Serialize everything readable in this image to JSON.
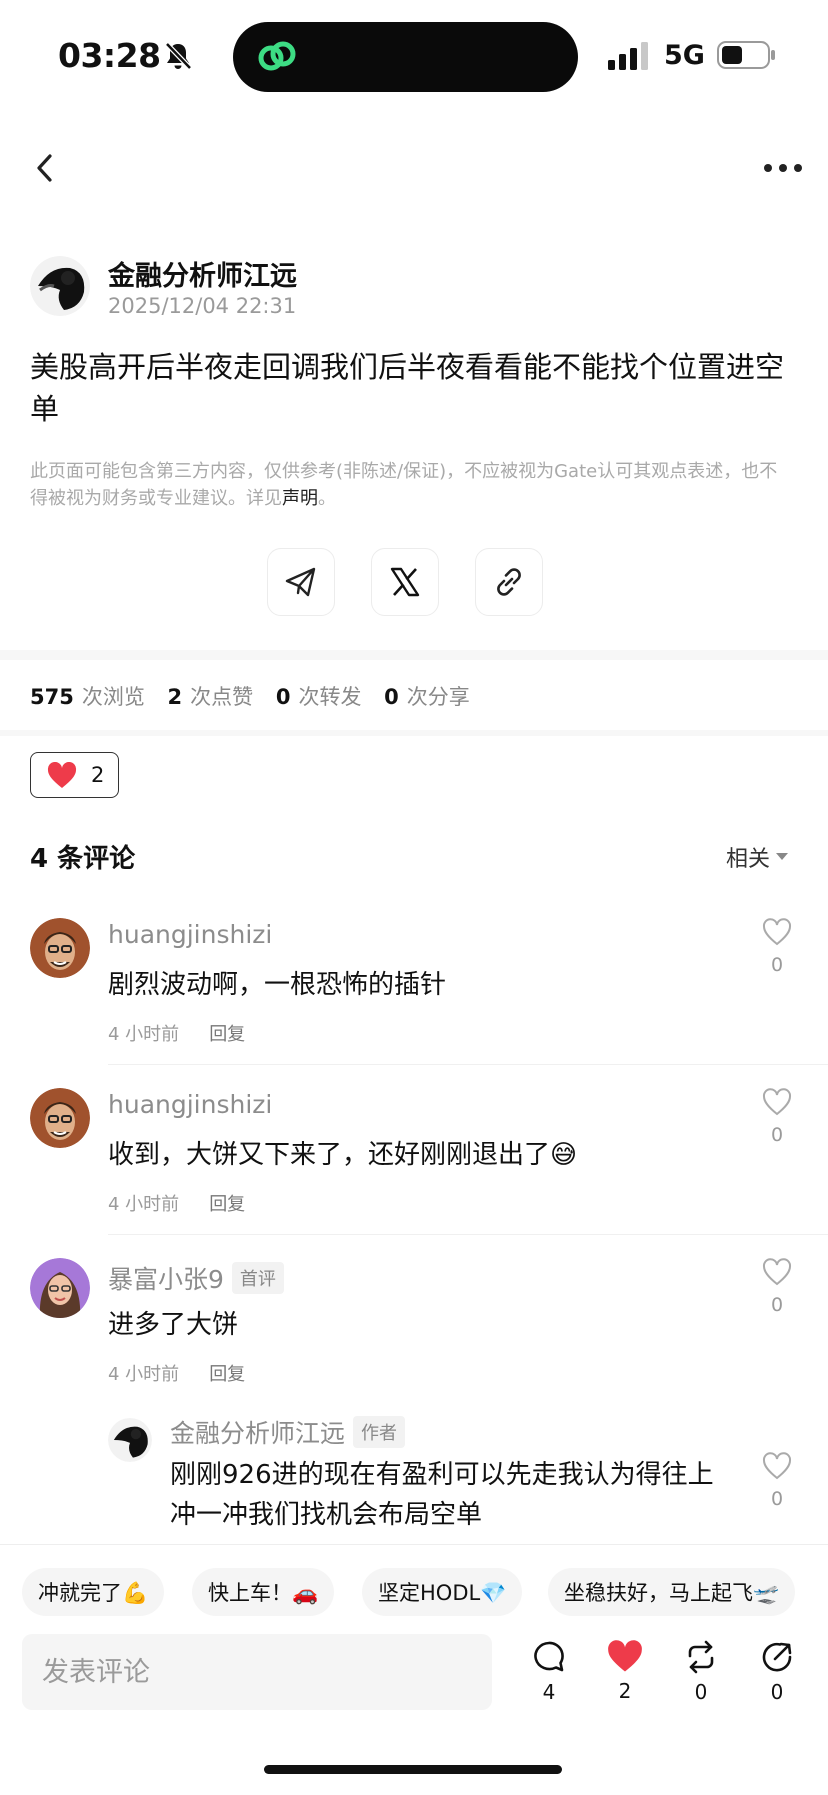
{
  "status_bar": {
    "time": "03:28",
    "network": "5G"
  },
  "author": {
    "name": "金融分析师江远",
    "timestamp": "2025/12/04 22:31"
  },
  "post": {
    "text": "美股高开后半夜走回调我们后半夜看看能不能找个位置进空单",
    "disclaimer": "此页面可能包含第三方内容，仅供参考(非陈述/保证)，不应被视为Gate认可其观点表述，也不得被视为财务或专业建议。详见",
    "disclaimer_link": "声明",
    "disclaimer_end": "。"
  },
  "stats": {
    "views": "575",
    "views_label": "次浏览",
    "likes": "2",
    "likes_label": "次点赞",
    "reposts": "0",
    "reposts_label": "次转发",
    "shares": "0",
    "shares_label": "次分享"
  },
  "reaction": {
    "count": "2"
  },
  "comments_header": {
    "title": "4 条评论",
    "sort": "相关"
  },
  "comments": [
    {
      "user": "huangjinshizi",
      "text": "剧烈波动啊，一根恐怖的插针",
      "time": "4 小时前",
      "reply": "回复",
      "likes": "0"
    },
    {
      "user": "huangjinshizi",
      "text": "收到，大饼又下来了，还好刚刚退出了😅",
      "time": "4 小时前",
      "reply": "回复",
      "likes": "0"
    },
    {
      "user": "暴富小张9",
      "tag": "首评",
      "text": "进多了大饼",
      "time": "4 小时前",
      "reply": "回复",
      "likes": "0"
    },
    {
      "user": "金融分析师江远",
      "tag": "作者",
      "text_line1": "刚刚926进的现在有盈利可以先走我认为得往上",
      "text_line2": "冲一冲我们找机会布局空单",
      "likes": "0"
    }
  ],
  "quick_replies": [
    "冲就完了💪",
    "快上车！🚗",
    "坚定HODL💎",
    "坐稳扶好，马上起飞🛫"
  ],
  "bottom_bar": {
    "input_placeholder": "发表评论",
    "comment_count": "4",
    "like_count": "2",
    "repost_count": "0",
    "share_count": "0"
  },
  "colors": {
    "like_red": "#ee3b4a",
    "muted_text": "#9a9a9a",
    "chip_bg": "#f5f5f5"
  }
}
